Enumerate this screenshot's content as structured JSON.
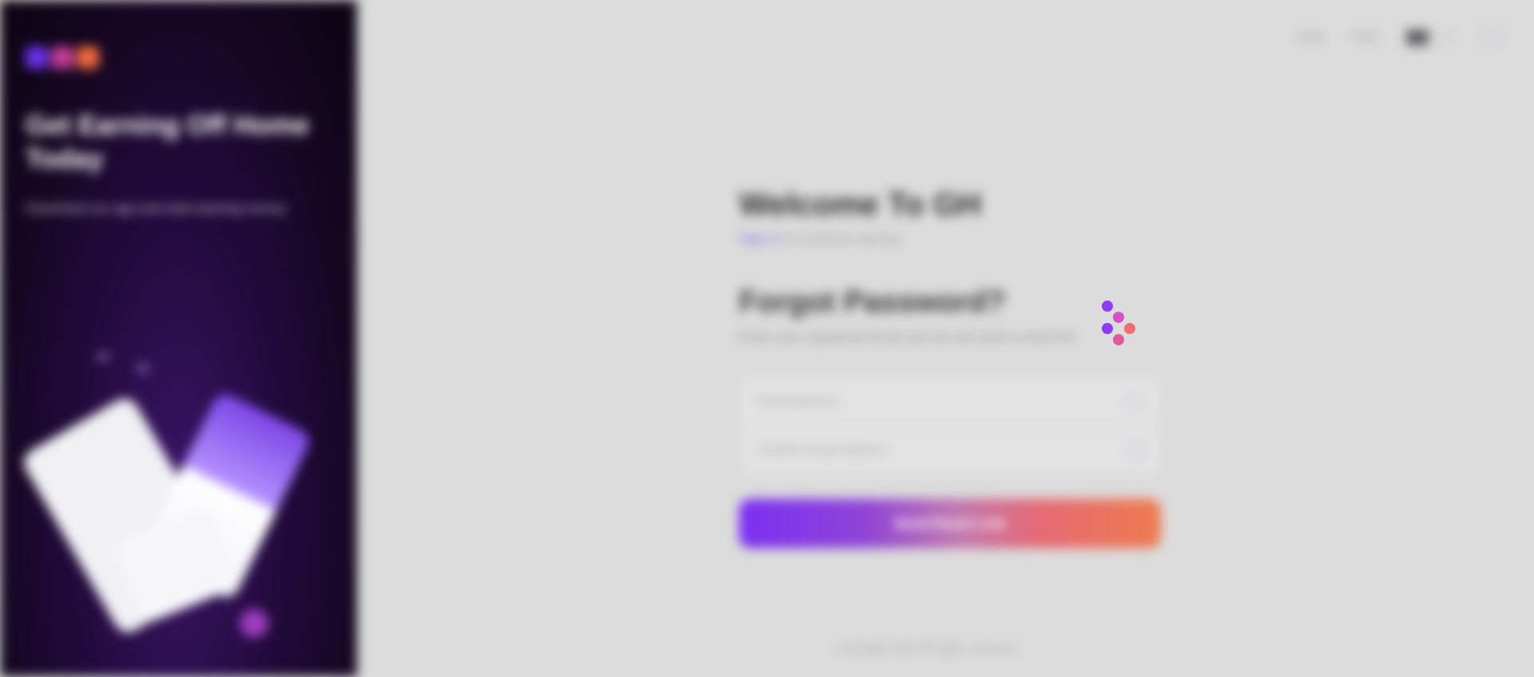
{
  "brand": {
    "logo_alt": "logo",
    "colors": [
      "#6a31e8",
      "#c43d9b",
      "#f06a3c"
    ]
  },
  "left": {
    "tagline": "Get Earning Off Home Today",
    "subline": "Download our app and start earning money"
  },
  "nav": {
    "help_label": "Help",
    "support_label": "FAQ",
    "language_label": "EN",
    "theme_icon": "toggle-icon"
  },
  "welcome": {
    "title": "Welcome To GH",
    "subtitle_accent": "Sign in",
    "subtitle_rest": "to continue earning"
  },
  "forgot": {
    "title": "Forgot Password?",
    "description": "Enter your registered email and we will send a reset link"
  },
  "form": {
    "field1_placeholder": "Email Address",
    "field2_placeholder": "Confirm Email Address",
    "submit_label": "Send Reset Link"
  },
  "footer": {
    "text": "Copyright 2024 All rights reserved"
  },
  "loader": {
    "colors": [
      "#8e3dff",
      "#d94fc8",
      "#f26d6d",
      "#8e3dff",
      "#e05a9b"
    ]
  }
}
